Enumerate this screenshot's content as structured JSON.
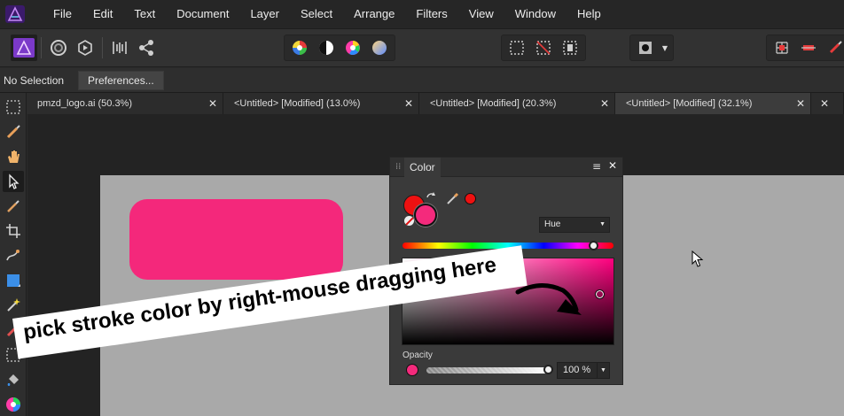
{
  "menu": {
    "items": [
      "File",
      "Edit",
      "Text",
      "Document",
      "Layer",
      "Select",
      "Arrange",
      "Filters",
      "View",
      "Window",
      "Help"
    ]
  },
  "toolbar": {
    "persona_icons": [
      "designer-persona-icon",
      "pixel-persona-icon",
      "export-persona-icon",
      "separator",
      "ruler-snap-icon",
      "share-icon"
    ],
    "color_icons": [
      "color-wheel-icon",
      "contrast-icon",
      "hue-wheel-icon",
      "gradient-icon"
    ],
    "select_icons": [
      "marquee-icon",
      "no-select-icon",
      "invert-icon"
    ],
    "snap_icons": [
      "snap-grid-icon",
      "snap-move-icon",
      "pen-icon"
    ]
  },
  "context": {
    "selection": "No Selection",
    "preferences": "Preferences..."
  },
  "tabs": [
    {
      "label": "pmzd_logo.ai (50.3%)",
      "active": false
    },
    {
      "label": "<Untitled> [Modified] (13.0%)",
      "active": false
    },
    {
      "label": "<Untitled> [Modified] (20.3%)",
      "active": false
    },
    {
      "label": "<Untitled> [Modified] (32.1%)",
      "active": true
    },
    {
      "label": "",
      "active": false
    }
  ],
  "color_panel": {
    "title": "Color",
    "model": "Hue",
    "opacity_label": "Opacity",
    "opacity_value": "100 %",
    "fill_color": "#ee1111",
    "stroke_color": "#f42a7c",
    "hue_position": 0.96,
    "opacity_level": 1.0
  },
  "annotation": {
    "text": "pick stroke color by right-mouse dragging here"
  },
  "colors": {
    "canvas": "#a9a9a9",
    "shape": "#f4287b"
  }
}
